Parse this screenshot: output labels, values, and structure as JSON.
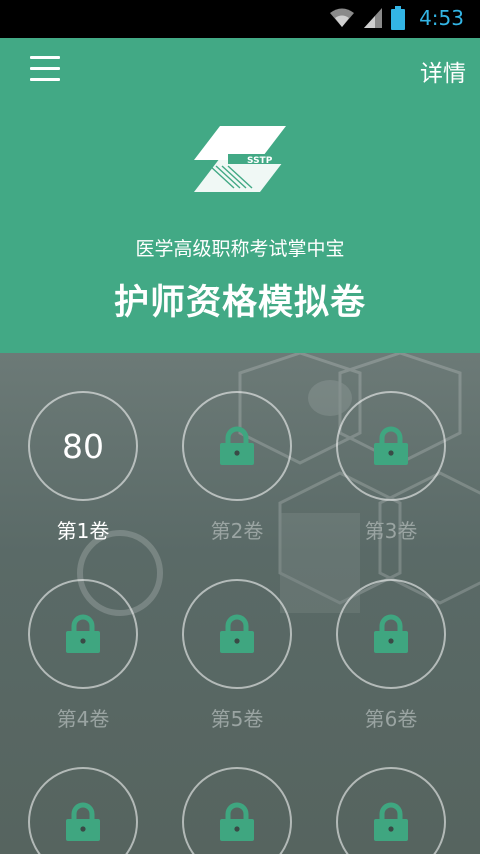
{
  "status_bar": {
    "time": "4:53",
    "icons": [
      "wifi-icon",
      "signal-icon",
      "battery-icon"
    ]
  },
  "header": {
    "detail_label": "详情",
    "subtitle": "医学高级职称考试掌中宝",
    "title": "护师资格模拟卷",
    "logo_text": "SSTP",
    "background_color": "#42a985"
  },
  "papers": [
    {
      "label": "第1卷",
      "score": "80",
      "locked": false
    },
    {
      "label": "第2卷",
      "score": "",
      "locked": true
    },
    {
      "label": "第3卷",
      "score": "",
      "locked": true
    },
    {
      "label": "第4卷",
      "score": "",
      "locked": true
    },
    {
      "label": "第5卷",
      "score": "",
      "locked": true
    },
    {
      "label": "第6卷",
      "score": "",
      "locked": true
    },
    {
      "label": "",
      "score": "",
      "locked": true
    },
    {
      "label": "",
      "score": "",
      "locked": true
    },
    {
      "label": "",
      "score": "",
      "locked": true
    }
  ],
  "colors": {
    "accent": "#42a985",
    "lock": "#3fa680",
    "status_blue": "#33b5e5"
  }
}
